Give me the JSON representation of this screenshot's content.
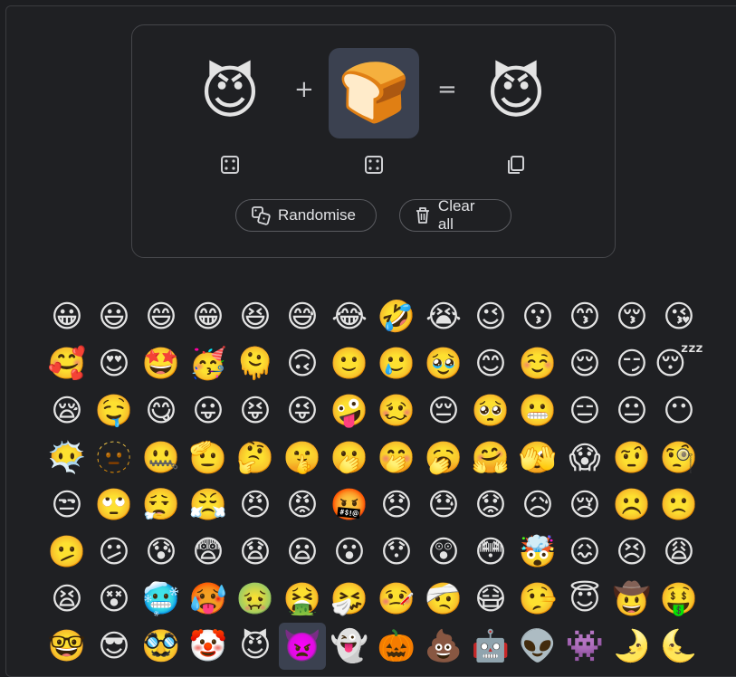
{
  "mixer": {
    "left_emoji": "😈",
    "right_emoji": "🍞",
    "result_emoji": "😈",
    "plus": "+",
    "equals": "=",
    "left_action_icon": "dice-icon",
    "right_action_icon": "dice-icon",
    "result_action_icon": "copy-icon"
  },
  "buttons": {
    "randomise_label": "Randomise",
    "clear_label": "Clear all"
  },
  "emoji_grid": [
    "😀",
    "😃",
    "😄",
    "😁",
    "😆",
    "😅",
    "😂",
    "🤣",
    "😭",
    "😉",
    "😗",
    "😙",
    "😚",
    "😘",
    "🥰",
    "😍",
    "🤩",
    "🥳",
    "🫠",
    "🙃",
    "🙂",
    "🥲",
    "🥹",
    "😊",
    "☺️",
    "😌",
    "😏",
    "😴",
    "😪",
    "🤤",
    "😋",
    "😛",
    "😝",
    "😜",
    "🤪",
    "🥴",
    "😔",
    "🥺",
    "😬",
    "😑",
    "😐",
    "😶",
    "😶‍🌫️",
    "🫥",
    "🤐",
    "🫡",
    "🤔",
    "🤫",
    "🫢",
    "🤭",
    "🥱",
    "🤗",
    "🫣",
    "😱",
    "🤨",
    "🧐",
    "😒",
    "🙄",
    "😮‍💨",
    "😤",
    "😠",
    "😡",
    "🤬",
    "😞",
    "😓",
    "😟",
    "😥",
    "😢",
    "☹️",
    "🙁",
    "🫤",
    "😕",
    "😰",
    "😨",
    "😧",
    "😦",
    "😮",
    "😯",
    "😲",
    "😳",
    "🤯",
    "😖",
    "😣",
    "😩",
    "😫",
    "😵",
    "🥶",
    "🥵",
    "🤢",
    "🤮",
    "🤧",
    "🤒",
    "🤕",
    "😷",
    "🤥",
    "😇",
    "🤠",
    "🤑",
    "🤓",
    "😎",
    "🥸",
    "🤡",
    "😈",
    "👿",
    "👻",
    "🎃",
    "💩",
    "🤖",
    "👽",
    "👾",
    "🌛",
    "🌜"
  ],
  "active_index": 103
}
